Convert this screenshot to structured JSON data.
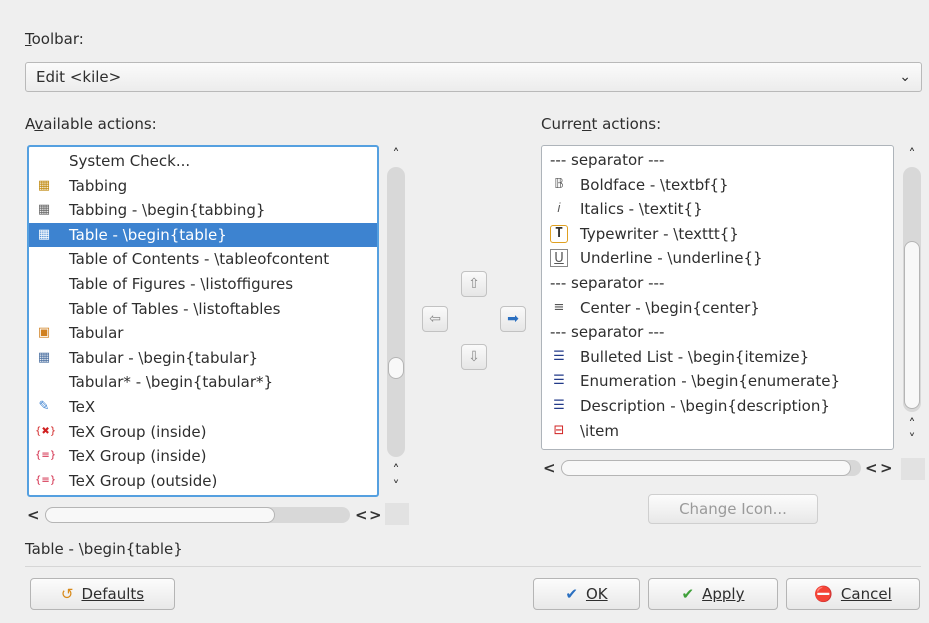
{
  "toolbar": {
    "label": "Toolbar:",
    "selected": "Edit <kile>"
  },
  "available": {
    "label": "Available actions:",
    "items": [
      {
        "label": "System Check...",
        "icon": "none"
      },
      {
        "label": "Tabbing",
        "icon": "tabbing-icon"
      },
      {
        "label": "Tabbing - \\begin{tabbing}",
        "icon": "tabbing-env-icon"
      },
      {
        "label": "Table - \\begin{table}",
        "icon": "table-icon",
        "selected": true
      },
      {
        "label": "Table of Contents - \\tableofcontent",
        "icon": "none"
      },
      {
        "label": "Table of Figures - \\listoffigures",
        "icon": "none"
      },
      {
        "label": "Table of Tables - \\listoftables",
        "icon": "none"
      },
      {
        "label": "Tabular",
        "icon": "tabular-wizard-icon"
      },
      {
        "label": "Tabular - \\begin{tabular}",
        "icon": "table-icon"
      },
      {
        "label": "Tabular* - \\begin{tabular*}",
        "icon": "none"
      },
      {
        "label": "TeX",
        "icon": "tex-icon"
      },
      {
        "label": "TeX Group (inside)",
        "icon": "tex-group-delete-icon"
      },
      {
        "label": "TeX Group (inside)",
        "icon": "tex-group-icon"
      },
      {
        "label": "TeX Group (outside)",
        "icon": "tex-group-icon"
      }
    ]
  },
  "current": {
    "label": "Current actions:",
    "items": [
      {
        "label": "--- separator ---",
        "icon": "none"
      },
      {
        "label": "Boldface - \\textbf{}",
        "icon": "bold-icon"
      },
      {
        "label": "Italics - \\textit{}",
        "icon": "italic-icon"
      },
      {
        "label": "Typewriter - \\texttt{}",
        "icon": "typewriter-icon"
      },
      {
        "label": "Underline - \\underline{}",
        "icon": "underline-icon"
      },
      {
        "label": "--- separator ---",
        "icon": "none"
      },
      {
        "label": "Center - \\begin{center}",
        "icon": "center-align-icon"
      },
      {
        "label": "--- separator ---",
        "icon": "none"
      },
      {
        "label": "Bulleted List - \\begin{itemize}",
        "icon": "bulleted-list-icon"
      },
      {
        "label": "Enumeration - \\begin{enumerate}",
        "icon": "numbered-list-icon"
      },
      {
        "label": "Description - \\begin{description}",
        "icon": "description-list-icon"
      },
      {
        "label": "\\item",
        "icon": "item-icon"
      }
    ]
  },
  "move": {
    "up": "⇧",
    "down": "⇩",
    "left": "⇦",
    "right": "➡"
  },
  "change_icon": "Change Icon...",
  "status": "Table - \\begin{table}",
  "buttons": {
    "defaults": "Defaults",
    "ok": "OK",
    "apply": "Apply",
    "cancel": "Cancel"
  },
  "colors": {
    "selection": "#3d83d0",
    "focus_border": "#55a0e0",
    "cancel": "#d42020",
    "ok": "#2a6fc0",
    "apply": "#3fa03a"
  }
}
